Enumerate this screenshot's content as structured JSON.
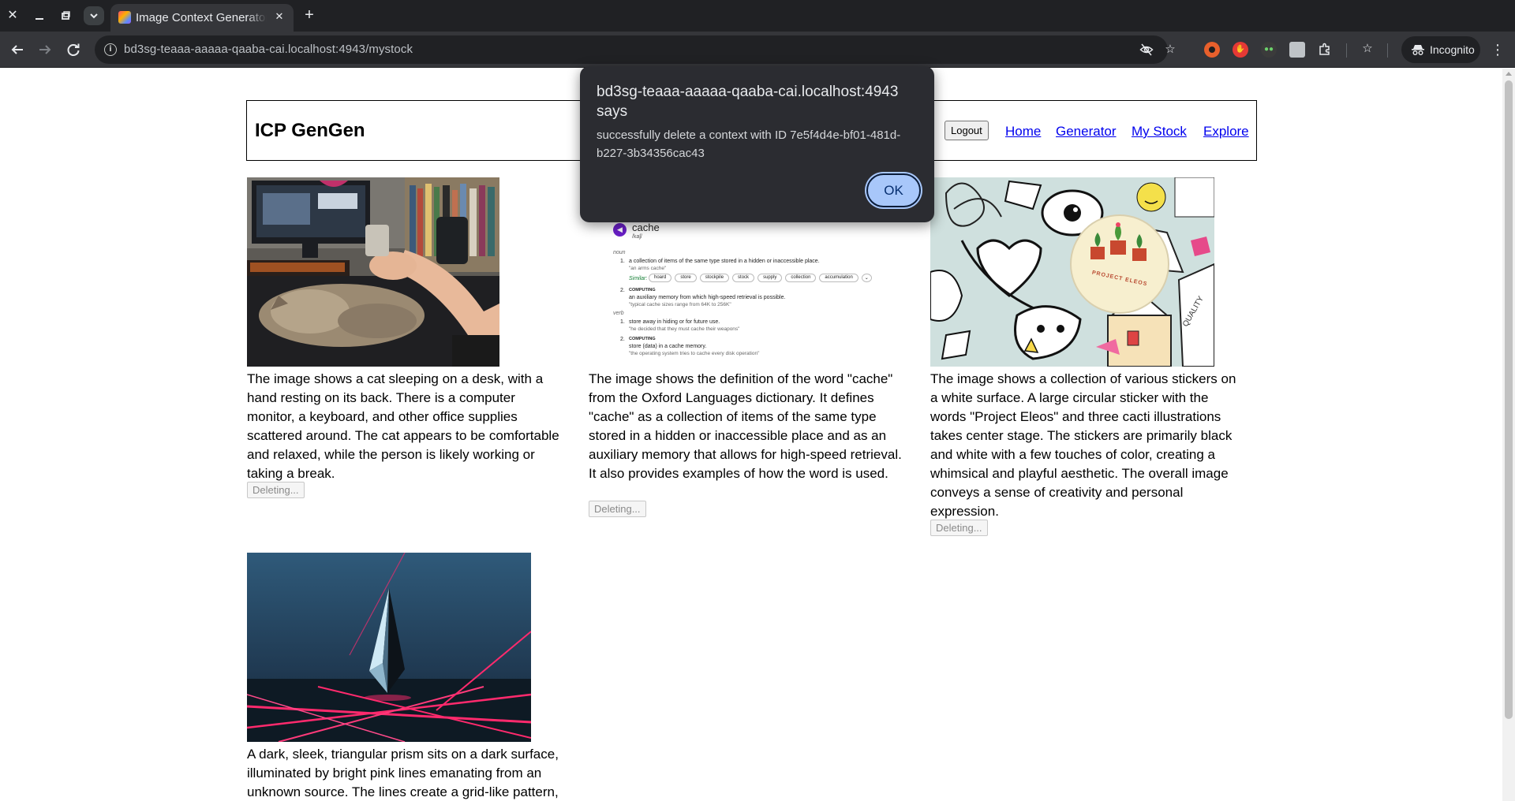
{
  "browser": {
    "tab_title": "Image Context Generator",
    "url": "bd3sg-teaaa-aaaaa-qaaba-cai.localhost:4943/mystock",
    "profile_label": "Incognito"
  },
  "site": {
    "title": "ICP GenGen",
    "logout_label": "Logout",
    "nav": [
      "Home",
      "Generator",
      "My Stock",
      "Explore"
    ]
  },
  "cards": [
    {
      "description": "The image shows a cat sleeping on a desk, with a hand resting on its back. There is a computer monitor, a keyboard, and other office supplies scattered around. The cat appears to be comfortable and relaxed, while the person is likely working or taking a break.",
      "button_label": "Deleting..."
    },
    {
      "description": "The image shows the definition of the word \"cache\" from the Oxford Languages dictionary. It defines \"cache\" as a collection of items of the same type stored in a hidden or inaccessible place and as an auxiliary memory that allows for high-speed retrieval. It also provides examples of how the word is used.",
      "button_label": "Deleting..."
    },
    {
      "description": "The image shows a collection of various stickers on a white surface. A large circular sticker with the words \"Project Eleos\" and three cacti illustrations takes center stage. The stickers are primarily black and white with a few touches of color, creating a whimsical and playful aesthetic. The overall image conveys a sense of creativity and personal expression.",
      "button_label": "Deleting..."
    },
    {
      "description": "A dark, sleek, triangular prism sits on a dark surface, illuminated by bright pink lines emanating from an unknown source. The lines create a grid-like pattern,"
    }
  ],
  "dictionary_image": {
    "word": "cache",
    "phonetic": "/kaʃ/",
    "pos_noun": "noun",
    "pos_verb": "verb",
    "def1": "a collection of items of the same type stored in a hidden or inaccessible place.",
    "ex1": "\"an arms cache\"",
    "similar_label": "Similar:",
    "similar": [
      "hoard",
      "store",
      "stockpile",
      "stock",
      "supply",
      "collection",
      "accumulation"
    ],
    "computing": "COMPUTING",
    "def2": "an auxiliary memory from which high-speed retrieval is possible.",
    "ex2": "\"typical cache sizes range from 64K to 256K\"",
    "def3": "store away in hiding or for future use.",
    "ex3": "\"he decided that they must cache their weapons\"",
    "def4": "store (data) in a cache memory.",
    "ex4": "\"the operating system tries to cache every disk operation\""
  },
  "sticker_image": {
    "badge_text": "PROJECT ELEOS"
  },
  "dialog": {
    "title": "bd3sg-teaaa-aaaaa-qaaba-cai.localhost:4943 says",
    "message": "successfully delete a context with ID 7e5f4d4e-bf01-481d-b227-3b34356cac43",
    "ok_label": "OK"
  },
  "colors": {
    "browser_frame": "#202124",
    "toolbar": "#35363a",
    "link": "#0000ee",
    "dialog_bg": "#2b2c31",
    "dialog_button": "#a8c7fa",
    "neon_pink": "#ff2a6d"
  },
  "icons": {
    "close_window": "close-icon",
    "minimize": "minimize-icon",
    "restore": "restore-icon",
    "back": "arrow-left-icon",
    "forward": "arrow-right-icon",
    "reload": "reload-icon",
    "site_info": "info-icon",
    "eye_off": "eye-off-icon",
    "bookmark": "star-icon",
    "extensions": "puzzle-icon",
    "menu": "kebab-icon"
  }
}
